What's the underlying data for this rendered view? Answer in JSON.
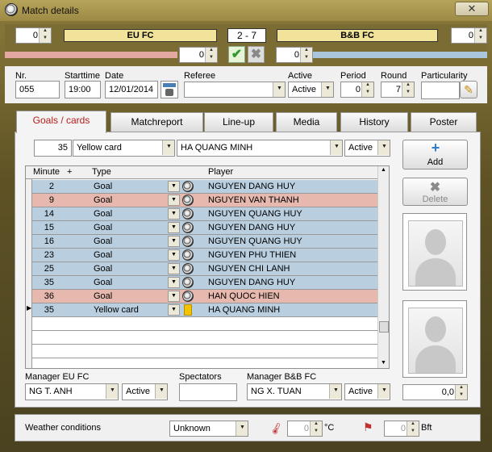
{
  "window": {
    "title": "Match details",
    "close_glyph": "✕"
  },
  "score": {
    "home_left_spin": "0",
    "home_team": "EU FC",
    "result": "2 - 7",
    "away_team": "B&B FC",
    "away_right_spin": "0",
    "home_small": "0",
    "away_small": "0",
    "home_color": "#e3a9a0",
    "away_color": "#a9c6dc"
  },
  "info": {
    "nr_label": "Nr.",
    "nr": "055",
    "starttime_label": "Starttime",
    "starttime": "19:00",
    "date_label": "Date",
    "date": "12/01/2014",
    "referee_label": "Referee",
    "referee": "",
    "active_label": "Active",
    "active": "Active",
    "period_label": "Period",
    "period": "0",
    "round_label": "Round",
    "round": "7",
    "particularity_label": "Particularity",
    "particularity": ""
  },
  "tabs": [
    "Goals / cards",
    "Matchreport",
    "Line-up",
    "Media",
    "History",
    "Poster"
  ],
  "entry": {
    "minute": "35",
    "type": "Yellow card",
    "player": "HA QUANG MINH",
    "status": "Active"
  },
  "buttons": {
    "add": "Add",
    "delete": "Delete"
  },
  "grid": {
    "headers": {
      "minute": "Minute",
      "sort": "+",
      "type": "Type",
      "player": "Player"
    },
    "rows": [
      {
        "minute": "2",
        "type": "Goal",
        "player": "NGUYEN DANG HUY",
        "team": "away"
      },
      {
        "minute": "9",
        "type": "Goal",
        "player": "NGUYEN VAN THANH",
        "team": "home"
      },
      {
        "minute": "14",
        "type": "Goal",
        "player": "NGUYEN QUANG HUY",
        "team": "away"
      },
      {
        "minute": "15",
        "type": "Goal",
        "player": "NGUYEN DANG HUY",
        "team": "away"
      },
      {
        "minute": "16",
        "type": "Goal",
        "player": "NGUYEN QUANG HUY",
        "team": "away"
      },
      {
        "minute": "23",
        "type": "Goal",
        "player": "NGUYEN PHU THIEN",
        "team": "away"
      },
      {
        "minute": "25",
        "type": "Goal",
        "player": "NGUYEN CHI LANH",
        "team": "away"
      },
      {
        "minute": "35",
        "type": "Goal",
        "player": "NGUYEN DANG HUY",
        "team": "away"
      },
      {
        "minute": "36",
        "type": "Goal",
        "player": "HAN QUOC HIEN",
        "team": "home"
      },
      {
        "minute": "35",
        "type": "Yellow card",
        "player": "HA QUANG MINH",
        "team": "away"
      }
    ]
  },
  "managers": {
    "home_label": "Manager EU FC",
    "home": "NG T. ANH",
    "home_status": "Active",
    "spectators_label": "Spectators",
    "spectators": "",
    "away_label": "Manager B&B FC",
    "away": "NG X. TUAN",
    "away_status": "Active",
    "rating": "0,0"
  },
  "weather": {
    "label": "Weather conditions",
    "condition": "Unknown",
    "temp": "0",
    "temp_unit": "°C",
    "wind": "0",
    "wind_unit": "Bft"
  }
}
